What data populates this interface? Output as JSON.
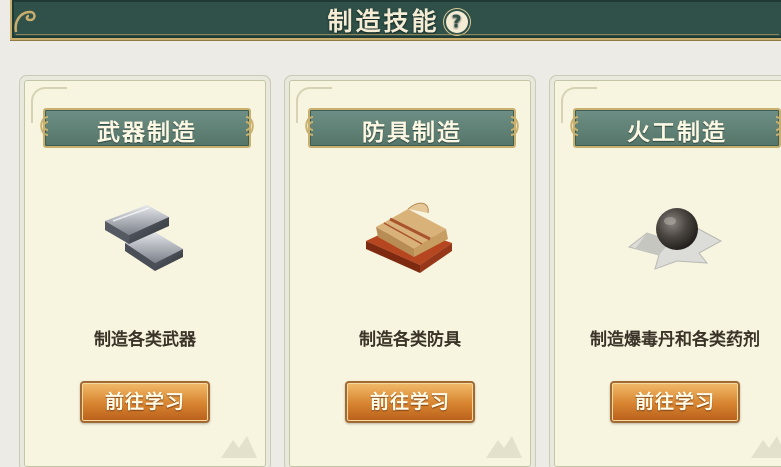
{
  "header": {
    "title": "制造技能",
    "help_icon": "question-circle-icon"
  },
  "cards": [
    {
      "title": "武器制造",
      "icon": "iron-ingot-icon",
      "description": "制造各类武器",
      "button_label": "前往学习"
    },
    {
      "title": "防具制造",
      "icon": "cloth-bundle-icon",
      "description": "制造各类防具",
      "button_label": "前往学习"
    },
    {
      "title": "火工制造",
      "icon": "bomb-ball-icon",
      "description": "制造爆毒丹和各类药剂",
      "button_label": "前往学习"
    }
  ],
  "colors": {
    "banner_bg": "#2f5149",
    "title_bar_bg": "#6e8f85",
    "gold_trim": "#c8b06e",
    "card_bg": "#f7f4df",
    "button_orange": "#d7832f"
  }
}
